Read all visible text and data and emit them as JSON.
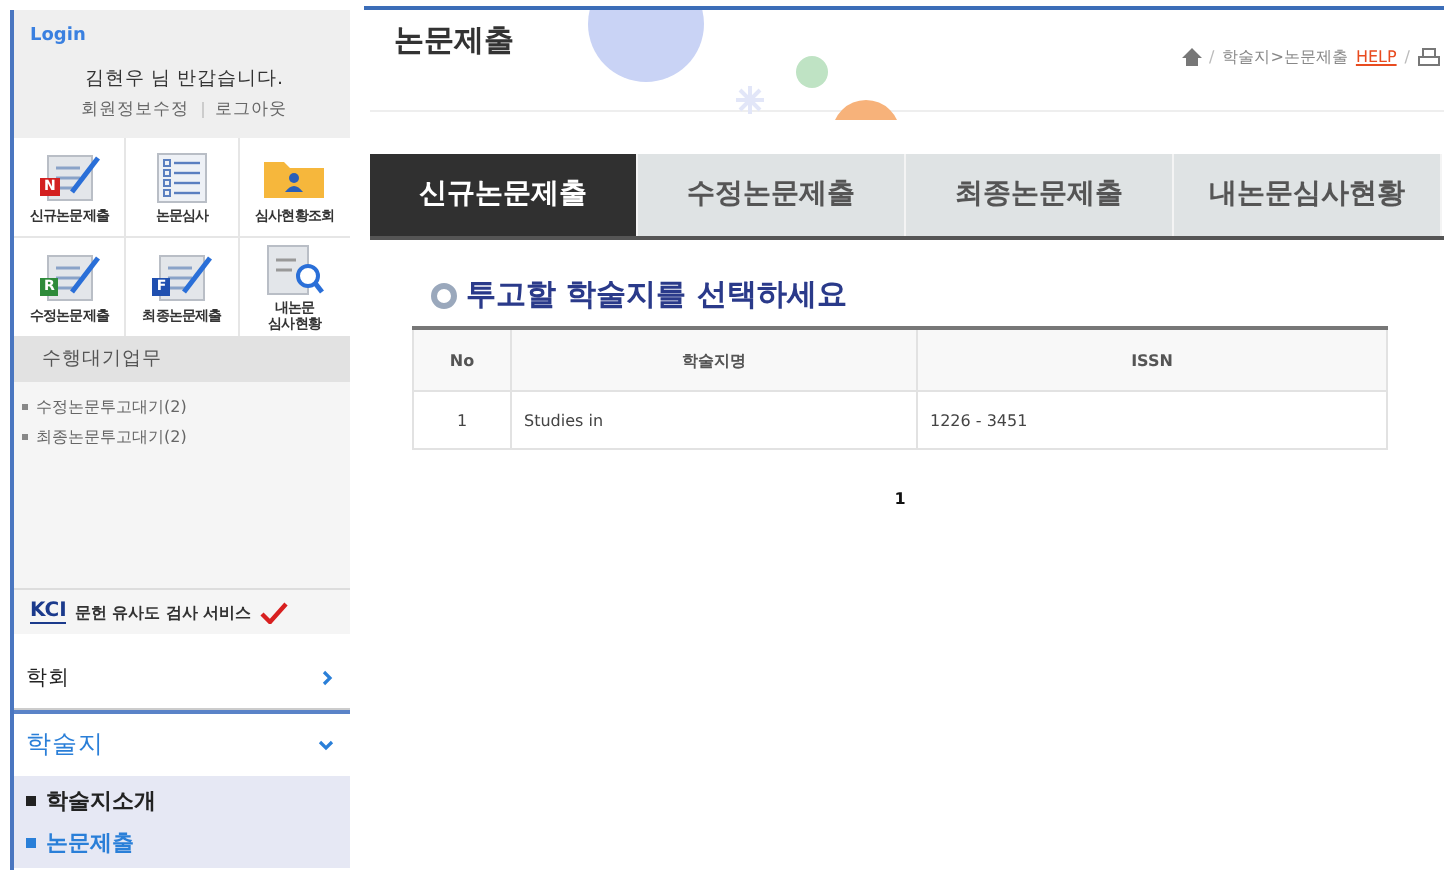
{
  "sidebar": {
    "login_label": "Login",
    "greeting": "김현우 님 반갑습니다.",
    "account_links": [
      {
        "label": "회원정보수정"
      },
      {
        "label": "로그아웃"
      }
    ],
    "quick_menu": [
      {
        "label": "신규논문제출",
        "kind": "document",
        "badge": "N"
      },
      {
        "label": "논문심사",
        "kind": "checklist"
      },
      {
        "label": "심사현황조회",
        "kind": "folder"
      },
      {
        "label": "수정논문제출",
        "kind": "document",
        "badge": "R"
      },
      {
        "label": "최종논문제출",
        "kind": "document",
        "badge": "F"
      },
      {
        "label": "내논문\n심사현황",
        "kind": "search"
      }
    ],
    "pending_title": "수행대기업무",
    "pending_items": [
      "수정논문투고대기(2)",
      "최종논문투고대기(2)"
    ],
    "kci": {
      "logo": "KCI",
      "label": "문헌 유사도 검사 서비스"
    },
    "nav": [
      {
        "label": "학회",
        "expanded": false
      },
      {
        "label": "학술지",
        "expanded": true,
        "children": [
          {
            "label": "학술지소개",
            "selected": false
          },
          {
            "label": "논문제출",
            "selected": true
          }
        ]
      }
    ]
  },
  "page_title": "논문제출",
  "breadcrumb": [
    {
      "kind": "home"
    },
    {
      "kind": "sep",
      "text": "/"
    },
    {
      "kind": "text",
      "text": "학술지>논문제출"
    },
    {
      "kind": "link",
      "text": "HELP"
    },
    {
      "kind": "sep",
      "text": "/"
    },
    {
      "kind": "print"
    }
  ],
  "tabs": [
    {
      "label": "신규논문제출",
      "selected": true
    },
    {
      "label": "수정논문제출",
      "selected": false
    },
    {
      "label": "최종논문제출",
      "selected": false
    },
    {
      "label": "내논문심사현황",
      "selected": false
    }
  ],
  "section_title": "투고할 학술지를 선택하세요",
  "table": {
    "columns": [
      "No",
      "학술지명",
      "ISSN"
    ],
    "rows": [
      [
        "1",
        "Studies in",
        "1226 - 3451"
      ]
    ]
  },
  "pagination": [
    {
      "label": "1",
      "selected": true
    }
  ]
}
